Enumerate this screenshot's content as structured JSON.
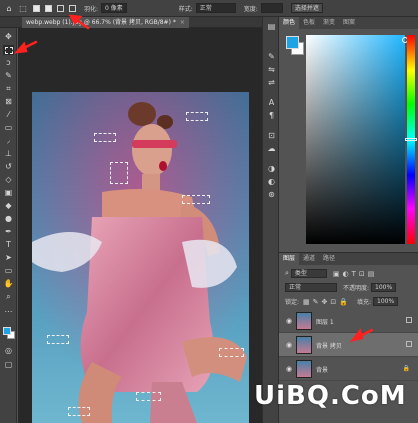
{
  "options_bar": {
    "feather_label": "羽化:",
    "feather_value": "0 像素",
    "style_label": "样式:",
    "style_value": "正常",
    "width_label": "宽度:",
    "select_subject": "选择并遮"
  },
  "document": {
    "tab_title": "webp.webp (1).jpg @ 66.7% (背景 拷贝, RGB/8#) *",
    "tab_close": "×"
  },
  "color_panel": {
    "tabs": [
      "颜色",
      "色板",
      "渐变",
      "图案"
    ],
    "foreground": "#1ea3e4",
    "background": "#ffffff"
  },
  "layers_panel": {
    "tabs": [
      "图层",
      "通道",
      "路径"
    ],
    "filter_kind": "类型",
    "blend_mode": "正常",
    "opacity_label": "不透明度:",
    "opacity_value": "100%",
    "lock_label": "锁定:",
    "fill_label": "填充:",
    "fill_value": "100%",
    "layers": [
      {
        "name": "图层 1"
      },
      {
        "name": "背景 拷贝"
      },
      {
        "name": "背景"
      }
    ]
  },
  "watermark": "UiBQ.CoM",
  "accent_color": "#ff2020"
}
